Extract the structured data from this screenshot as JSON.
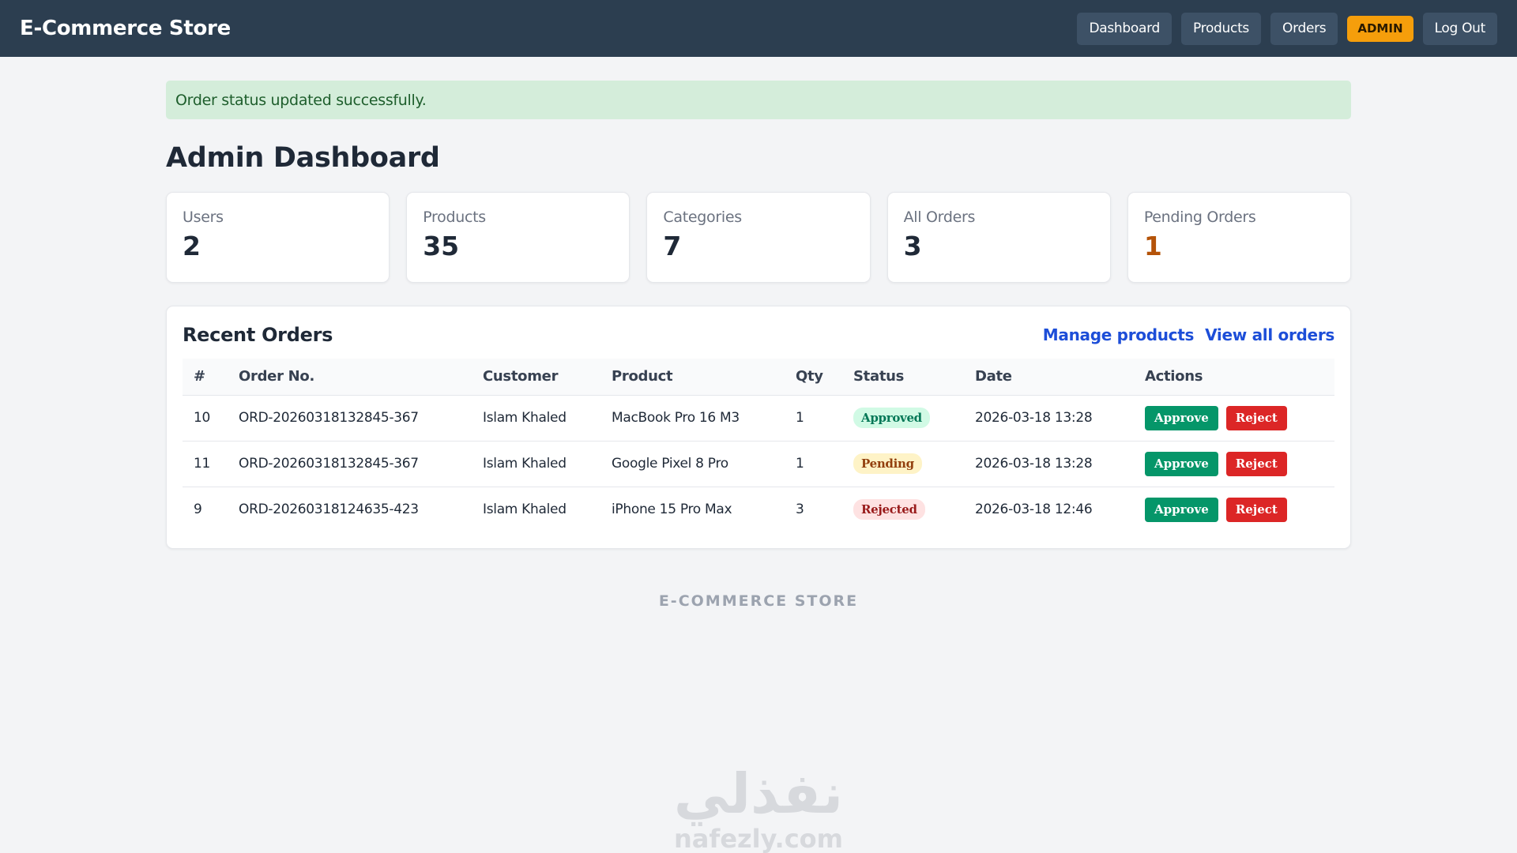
{
  "header": {
    "brand": "E-Commerce Store",
    "nav": {
      "dashboard": "Dashboard",
      "products": "Products",
      "orders": "Orders",
      "role_badge": "ADMIN",
      "logout": "Log Out"
    }
  },
  "alert": {
    "message": "Order status updated successfully."
  },
  "page_title": "Admin Dashboard",
  "stats": [
    {
      "label": "Users",
      "value": "2"
    },
    {
      "label": "Products",
      "value": "35"
    },
    {
      "label": "Categories",
      "value": "7"
    },
    {
      "label": "All Orders",
      "value": "3"
    },
    {
      "label": "Pending Orders",
      "value": "1"
    }
  ],
  "recent_orders": {
    "title": "Recent Orders",
    "links": {
      "manage_products": "Manage products",
      "view_all_orders": "View all orders"
    },
    "columns": [
      "#",
      "Order No.",
      "Customer",
      "Product",
      "Qty",
      "Status",
      "Date",
      "Actions"
    ],
    "rows": [
      {
        "id": "10",
        "order_no": "ORD-20260318132845-367",
        "customer": "Islam Khaled",
        "product": "MacBook Pro 16 M3",
        "qty": "1",
        "status": "Approved",
        "date": "2026-03-18 13:28",
        "approve": "Approve",
        "reject": "Reject"
      },
      {
        "id": "11",
        "order_no": "ORD-20260318132845-367",
        "customer": "Islam Khaled",
        "product": "Google Pixel 8 Pro",
        "qty": "1",
        "status": "Pending",
        "date": "2026-03-18 13:28",
        "approve": "Approve",
        "reject": "Reject"
      },
      {
        "id": "9",
        "order_no": "ORD-20260318124635-423",
        "customer": "Islam Khaled",
        "product": "iPhone 15 Pro Max",
        "qty": "3",
        "status": "Rejected",
        "date": "2026-03-18 12:46",
        "approve": "Approve",
        "reject": "Reject"
      }
    ]
  },
  "footer": {
    "text": "E-COMMERCE STORE"
  },
  "watermark": {
    "arabic": "نفذلي",
    "latin": "nafezly.com"
  },
  "colors": {
    "header_bg": "#2c3e50",
    "admin_badge": "#f59e0b",
    "link": "#1d4ed8",
    "approve": "#059669",
    "reject": "#dc2626",
    "pending_value": "#b45309"
  }
}
